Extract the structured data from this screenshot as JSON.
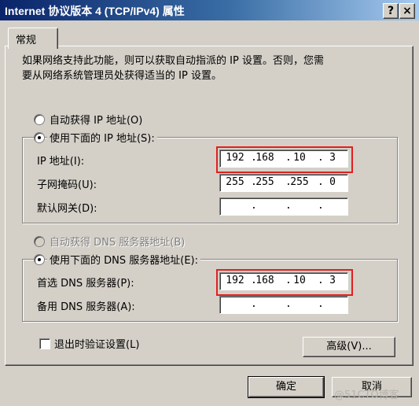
{
  "window": {
    "title": "Internet 协议版本 4 (TCP/IPv4) 属性",
    "help_btn": "?",
    "close_btn": "×"
  },
  "tab": {
    "label": "常规"
  },
  "description": {
    "line1": "如果网络支持此功能，则可以获取自动指派的 IP 设置。否则，您需",
    "line2": "要从网络系统管理员处获得适当的 IP 设置。"
  },
  "ip_section": {
    "auto_label": "自动获得 IP 地址(O)",
    "manual_label": "使用下面的 IP 地址(S):",
    "selected": "manual",
    "ip_label": "IP 地址(I):",
    "ip_value": [
      "192",
      "168",
      "10",
      "3"
    ],
    "mask_label": "子网掩码(U):",
    "mask_value": [
      "255",
      "255",
      "255",
      "0"
    ],
    "gateway_label": "默认网关(D):",
    "gateway_value": [
      "",
      "",
      "",
      ""
    ]
  },
  "dns_section": {
    "auto_label": "自动获得 DNS 服务器地址(B)",
    "auto_disabled": true,
    "manual_label": "使用下面的 DNS 服务器地址(E):",
    "selected": "manual",
    "preferred_label": "首选 DNS 服务器(P):",
    "preferred_value": [
      "192",
      "168",
      "10",
      "3"
    ],
    "alternate_label": "备用 DNS 服务器(A):",
    "alternate_value": [
      "",
      "",
      "",
      ""
    ]
  },
  "validate_checkbox": {
    "label": "退出时验证设置(L)",
    "checked": false
  },
  "advanced_button": {
    "label": "高级(V)..."
  },
  "ok_button": {
    "label": "确定"
  },
  "cancel_button": {
    "label": "取消"
  },
  "watermark": "@51CTO博客",
  "colors": {
    "highlight_box": "#e02020",
    "title_start": "#0a246a",
    "title_end": "#a6caf0"
  }
}
